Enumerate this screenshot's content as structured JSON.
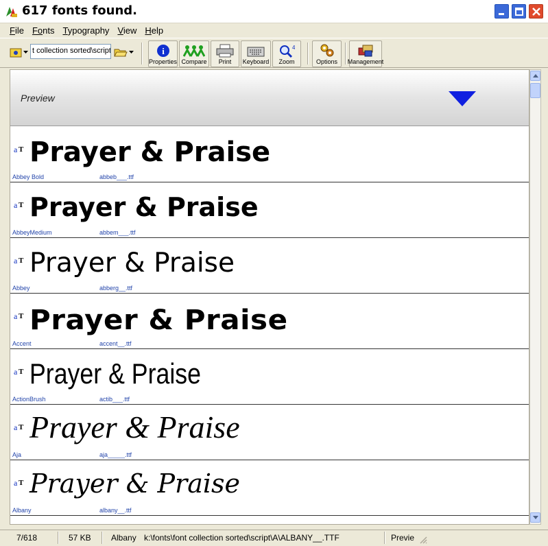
{
  "window": {
    "title": "617 fonts found."
  },
  "menu": [
    {
      "underline": "F",
      "rest": "ile"
    },
    {
      "underline": "Fo",
      "rest": "nts"
    },
    {
      "underline": "T",
      "rest": "ypography"
    },
    {
      "underline": "V",
      "rest": "iew"
    },
    {
      "underline": "H",
      "rest": "elp"
    }
  ],
  "toolbar": {
    "path_value": "t collection sorted\\script",
    "properties_label": "Properties",
    "compare_label": "Compare",
    "print_label": "Print",
    "keyboard_label": "Keyboard",
    "zoom_label": "Zoom",
    "options_label": "Options",
    "management_label": "Management"
  },
  "preview": {
    "label": "Preview"
  },
  "fonts": [
    {
      "sample": "Prayer & Praise",
      "name": "Abbey Bold",
      "file": "abbeb___.ttf"
    },
    {
      "sample": "Prayer & Praise",
      "name": "AbbeyMedium",
      "file": "abbem___.ttf"
    },
    {
      "sample": "Prayer & Praise",
      "name": "Abbey",
      "file": "abberg__.ttf"
    },
    {
      "sample": "Prayer & Praise",
      "name": "Accent",
      "file": "accent__.ttf"
    },
    {
      "sample": "Prayer & Praise",
      "name": "ActionBrush",
      "file": "actib___.ttf"
    },
    {
      "sample": "Prayer & Praise",
      "name": "Aja",
      "file": "aja_____.ttf"
    },
    {
      "sample": "Prayer & Praise",
      "name": "Albany",
      "file": "albany__.ttf"
    }
  ],
  "status": {
    "position": "7/618",
    "size": "57 KB",
    "font": "Albany",
    "path": "k:\\fonts\\font collection sorted\\script\\A\\ALBANY__.TTF",
    "mode": "Previe"
  },
  "colors": {
    "accent_blue": "#1020e0",
    "link_blue": "#2244aa"
  }
}
